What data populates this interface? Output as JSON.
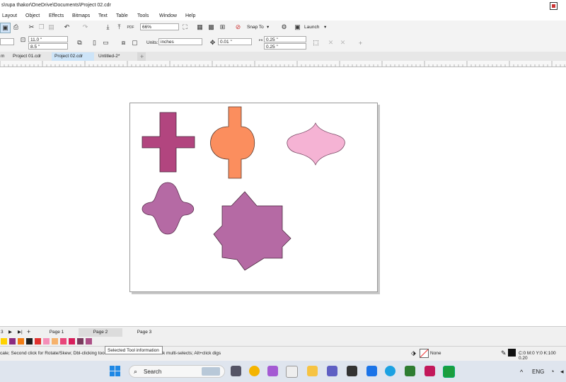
{
  "window": {
    "title": "s\\rupa thakor\\OneDrive\\Documents\\Project 02.cdr"
  },
  "menu": [
    "Layout",
    "Object",
    "Effects",
    "Bitmaps",
    "Text",
    "Table",
    "Tools",
    "Window",
    "Help"
  ],
  "toolbar": {
    "zoom": "66%",
    "snap_to": "Snap To",
    "launch": "Launch",
    "pdf": "PDF"
  },
  "propertybar": {
    "width": "11.0 \"",
    "height": "8.5 \"",
    "units_label": "Units:",
    "units": "inches",
    "nudge": "0.01 \"",
    "dup_x": "0.25 \"",
    "dup_y": "0.25 \""
  },
  "doc_tabs": [
    {
      "label": "m",
      "active": false
    },
    {
      "label": "Project 01.cdr",
      "active": false
    },
    {
      "label": "Project 02.cdr",
      "active": true
    },
    {
      "label": "Untitled-2*",
      "active": false
    }
  ],
  "pages": {
    "items": [
      "Page 1",
      "Page 2",
      "Page 3"
    ],
    "active": 1,
    "prefix": "3"
  },
  "status": {
    "hint": "cale; Second click for Rotate/Skew; Dbl-clicking too",
    "hint2": "k multi-selects; Alt+click digs",
    "tooltip": "Selected Tool information",
    "fill": "None",
    "color_values": "C:0 M:0 Y:0 K:100  0.20"
  },
  "shapes": {
    "cross": "#b2457f",
    "rounded_oval": "#fb8e5e",
    "pink_lens": "#f5b3d4",
    "flower": "#b56aa4",
    "star": "#b56aa4"
  },
  "palette": [
    "#ffd200",
    "#8b2a7f",
    "#f07c13",
    "#1e1e1e",
    "#e0322f",
    "#f48fb8",
    "#f6b26b",
    "#e8467a",
    "#d81e5b",
    "#7a3b5e",
    "#ac4f86"
  ],
  "taskbar": {
    "search": "Search",
    "language": "ENG"
  }
}
